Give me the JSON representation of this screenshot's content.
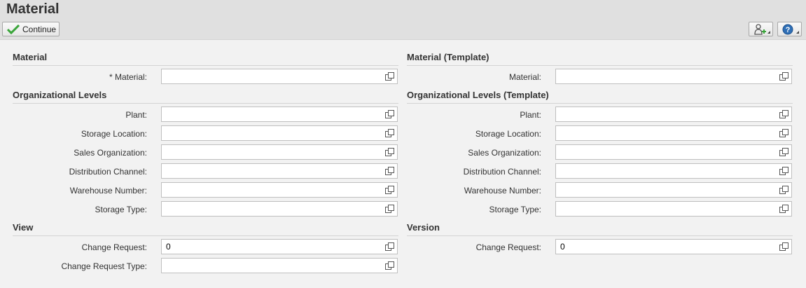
{
  "header": {
    "title": "Material"
  },
  "toolbar": {
    "continue_label": "Continue",
    "buttons": [
      {
        "icon": "user-settings-icon"
      },
      {
        "icon": "help-icon"
      }
    ]
  },
  "left": {
    "material_section": "Material",
    "material_label": "Material:",
    "required_marker": "*",
    "material_value": "",
    "org_section": "Organizational Levels",
    "org_fields": [
      {
        "label": "Plant:",
        "value": ""
      },
      {
        "label": "Storage Location:",
        "value": ""
      },
      {
        "label": "Sales Organization:",
        "value": ""
      },
      {
        "label": "Distribution Channel:",
        "value": ""
      },
      {
        "label": "Warehouse Number:",
        "value": ""
      },
      {
        "label": "Storage Type:",
        "value": ""
      }
    ],
    "view_section": "View",
    "change_request_label": "Change Request:",
    "change_request_value": "0",
    "change_request_type_label": "Change Request Type:",
    "change_request_type_value": ""
  },
  "right": {
    "material_section": "Material (Template)",
    "material_label": "Material:",
    "material_value": "",
    "org_section": "Organizational Levels (Template)",
    "org_fields": [
      {
        "label": "Plant:",
        "value": ""
      },
      {
        "label": "Storage Location:",
        "value": ""
      },
      {
        "label": "Sales Organization:",
        "value": ""
      },
      {
        "label": "Distribution Channel:",
        "value": ""
      },
      {
        "label": "Warehouse Number:",
        "value": ""
      },
      {
        "label": "Storage Type:",
        "value": ""
      }
    ],
    "version_section": "Version",
    "change_request_label": "Change Request:",
    "change_request_value": "0"
  },
  "colors": {
    "accent_check": "#3aa53a",
    "help_blue": "#2f6fb6"
  }
}
